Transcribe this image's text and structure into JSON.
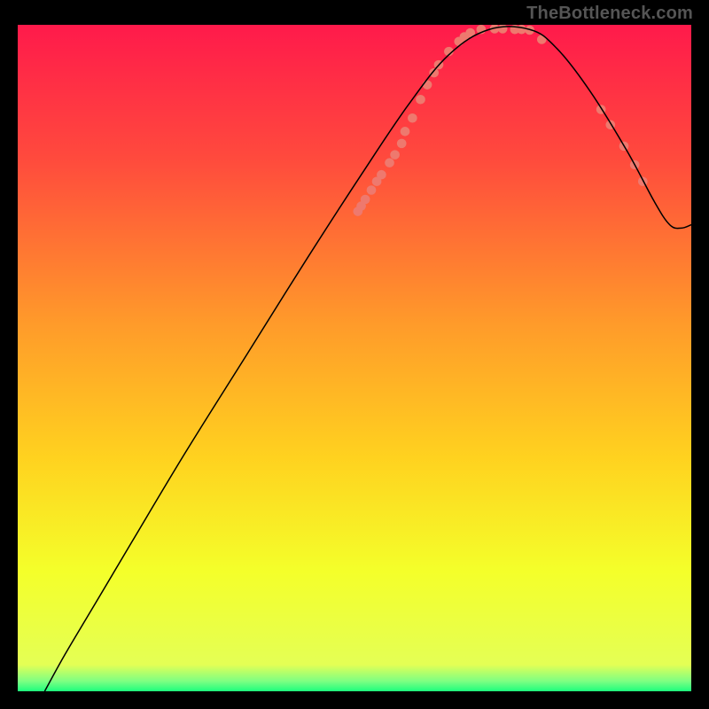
{
  "watermark": "TheBottleneck.com",
  "chart_data": {
    "type": "line",
    "title": "",
    "xlabel": "",
    "ylabel": "",
    "xlim": [
      0,
      1000
    ],
    "ylim": [
      0,
      1000
    ],
    "gradient_stops": [
      {
        "offset": 0.0,
        "color": "#ff1a4b"
      },
      {
        "offset": 0.2,
        "color": "#ff4a3d"
      },
      {
        "offset": 0.45,
        "color": "#ff9b2a"
      },
      {
        "offset": 0.65,
        "color": "#ffd21f"
      },
      {
        "offset": 0.82,
        "color": "#f4ff2a"
      },
      {
        "offset": 0.96,
        "color": "#e4ff55"
      },
      {
        "offset": 0.985,
        "color": "#7dff83"
      },
      {
        "offset": 1.0,
        "color": "#1dfd7d"
      }
    ],
    "curve": [
      {
        "x": 40,
        "y": 0
      },
      {
        "x": 70,
        "y": 55
      },
      {
        "x": 110,
        "y": 123
      },
      {
        "x": 170,
        "y": 225
      },
      {
        "x": 250,
        "y": 360
      },
      {
        "x": 340,
        "y": 505
      },
      {
        "x": 430,
        "y": 650
      },
      {
        "x": 510,
        "y": 775
      },
      {
        "x": 580,
        "y": 880
      },
      {
        "x": 640,
        "y": 955
      },
      {
        "x": 700,
        "y": 993
      },
      {
        "x": 760,
        "y": 993
      },
      {
        "x": 800,
        "y": 965
      },
      {
        "x": 850,
        "y": 900
      },
      {
        "x": 905,
        "y": 810
      },
      {
        "x": 945,
        "y": 735
      },
      {
        "x": 968,
        "y": 700
      },
      {
        "x": 985,
        "y": 695
      },
      {
        "x": 1000,
        "y": 700
      }
    ],
    "scatter_points": [
      {
        "x": 505,
        "y": 720
      },
      {
        "x": 510,
        "y": 728
      },
      {
        "x": 516,
        "y": 738
      },
      {
        "x": 525,
        "y": 752
      },
      {
        "x": 533,
        "y": 765
      },
      {
        "x": 540,
        "y": 775
      },
      {
        "x": 552,
        "y": 793
      },
      {
        "x": 560,
        "y": 805
      },
      {
        "x": 570,
        "y": 822
      },
      {
        "x": 575,
        "y": 840
      },
      {
        "x": 586,
        "y": 860
      },
      {
        "x": 598,
        "y": 888
      },
      {
        "x": 608,
        "y": 910
      },
      {
        "x": 618,
        "y": 928
      },
      {
        "x": 625,
        "y": 940
      },
      {
        "x": 640,
        "y": 960
      },
      {
        "x": 655,
        "y": 975
      },
      {
        "x": 663,
        "y": 982
      },
      {
        "x": 672,
        "y": 988
      },
      {
        "x": 688,
        "y": 993
      },
      {
        "x": 708,
        "y": 994
      },
      {
        "x": 720,
        "y": 994
      },
      {
        "x": 738,
        "y": 993
      },
      {
        "x": 748,
        "y": 993
      },
      {
        "x": 760,
        "y": 992
      },
      {
        "x": 778,
        "y": 978
      },
      {
        "x": 866,
        "y": 873
      },
      {
        "x": 880,
        "y": 850
      },
      {
        "x": 900,
        "y": 818
      },
      {
        "x": 916,
        "y": 790
      },
      {
        "x": 928,
        "y": 765
      }
    ],
    "scatter_radius": 7,
    "scatter_color": "#ee796e",
    "line_color": "#000000",
    "line_width": 2
  }
}
